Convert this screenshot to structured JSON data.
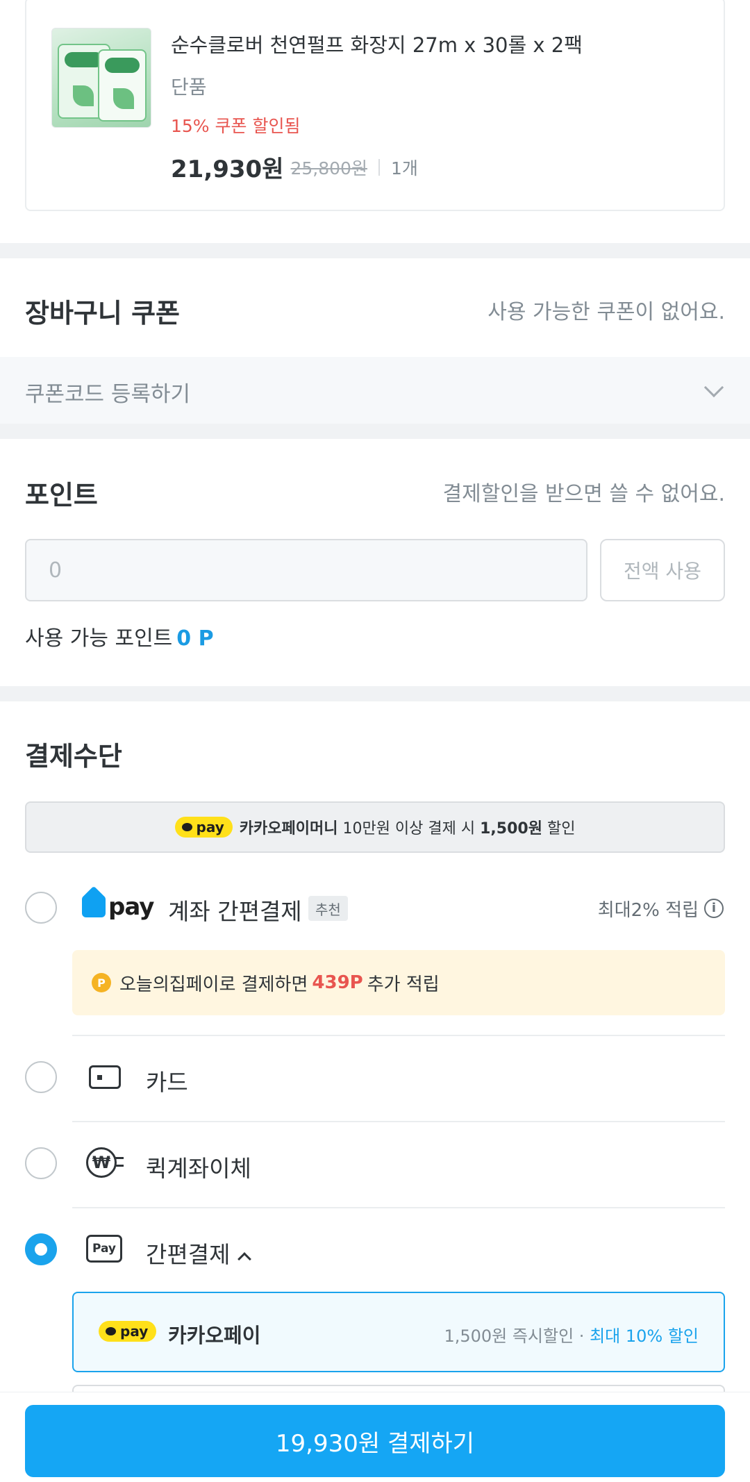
{
  "product": {
    "name": "순수클로버 천연펄프 화장지 27m x 30롤 x 2팩",
    "option": "단품",
    "coupon_note": "15% 쿠폰 할인됨",
    "sale_price": "21,930원",
    "original_price": "25,800원",
    "quantity": "1개"
  },
  "cart_coupon": {
    "title": "장바구니 쿠폰",
    "status": "사용 가능한 쿠폰이 없어요.",
    "code_label": "쿠폰코드 등록하기"
  },
  "points": {
    "title": "포인트",
    "note": "결제할인을 받으면 쓸 수 없어요.",
    "input_placeholder": "0",
    "use_all_label": "전액 사용",
    "available_label": "사용 가능 포인트",
    "available_value": "0 P"
  },
  "payment": {
    "title": "결제수단",
    "promo_banner": {
      "pill": "pay",
      "brand": "카카오페이머니",
      "text_before": "10만원 이상 결제 시",
      "amount": "1,500원",
      "text_after": "할인"
    },
    "methods": [
      {
        "label": "계좌 간편결제",
        "logo_text": "pay",
        "badge": "추천",
        "reward": "최대2% 적립",
        "selected": false
      },
      {
        "label": "카드",
        "selected": false
      },
      {
        "label": "퀵계좌이체",
        "selected": false
      },
      {
        "label": "간편결제",
        "selected": true
      }
    ],
    "extra_point": {
      "coin": "P",
      "text_before": "오늘의집페이로 결제하면",
      "amount": "439P",
      "text_after": "추가 적립"
    },
    "pay_icon_text": "Pay",
    "won_icon_text": "₩",
    "easy_pay_options": [
      {
        "pill": "pay",
        "name": "카카오페이",
        "note": "1,500원 즉시할인 ·",
        "highlight": "최대 10% 할인"
      }
    ]
  },
  "checkout": {
    "button_label": "19,930원 결제하기"
  },
  "colors": {
    "accent": "#15a6f4",
    "kakao_yellow": "#ffe01a",
    "discount_red": "#e8554f",
    "point_blue": "#1b9be3"
  }
}
